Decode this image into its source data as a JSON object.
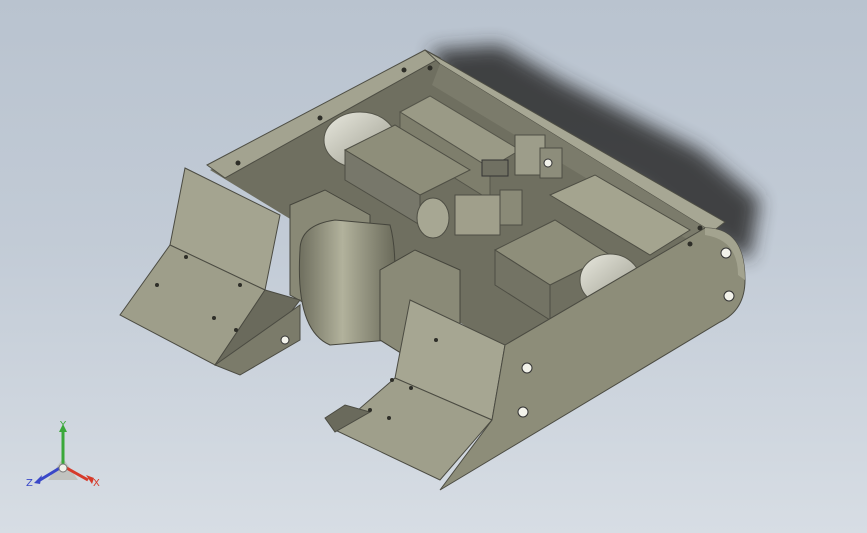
{
  "viewport": {
    "background_top": "#b9c3cf",
    "background_bottom": "#d7dde4"
  },
  "model": {
    "body_color": "#8b8b78",
    "body_dark": "#5a5a4e",
    "body_light": "#a5a591",
    "shadow_color": "#2c2c2c"
  },
  "triad": {
    "x_label": "X",
    "y_label": "Y",
    "z_label": "Z",
    "x_color": "#d63a2a",
    "y_color": "#3aa83a",
    "z_color": "#3a48c8"
  }
}
